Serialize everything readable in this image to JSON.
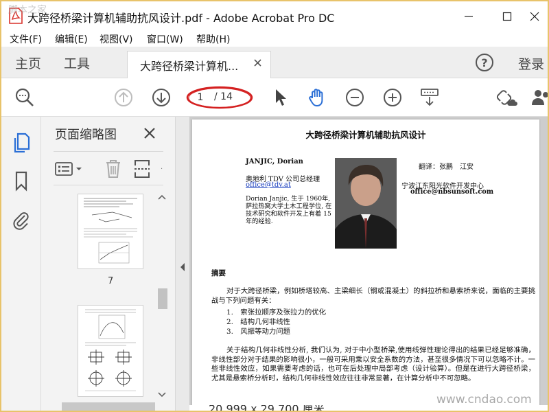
{
  "window": {
    "title": "大跨径桥梁计算机辅助抗风设计.pdf - Adobe Acrobat Pro DC"
  },
  "menu": [
    "文件(F)",
    "编辑(E)",
    "视图(V)",
    "窗口(W)",
    "帮助(H)"
  ],
  "tabs": {
    "home": "主页",
    "tools": "工具",
    "document": "大跨径桥梁计算机...",
    "login": "登录"
  },
  "toolbar": {
    "page_current": "1",
    "page_total": "/ 14"
  },
  "panel": {
    "title": "页面缩略图",
    "page_label": "7"
  },
  "document": {
    "title": "大跨径桥梁计算机辅助抗风设计",
    "author_name": "JANJIC, Dorian",
    "author_org": "奥地利 TDV 公司总经理",
    "author_email": "office@tdv.at",
    "author_bio": "Dorian Janjic, 生于 1960年, 萨拉热窝大学土木工程学位, 在技术研究和软件开发上有着 15年的经验.",
    "translator": "翻译：张鹏　江安",
    "translator_company": "宁波江东阳光软件开发中心",
    "translator_email": "office@nbsunsoft.com",
    "abstract_heading": "摘要",
    "para1": "对于大跨径桥梁，例如桥塔较高、主梁细长（钢或混凝土）的斜拉桥和悬索桥来说，面临的主要挑战与下列问题有关：",
    "list": [
      "1.　索张拉顺序及张拉力的优化",
      "2.　结构几何非线性",
      "3.　风振等动力问题"
    ],
    "para2": "关于结构几何非线性分析, 我们认为, 对于中小型桥梁,使用线弹性理论得出的结果已经足够准确，非线性部分对于结果的影响很小，一般可采用乘以安全系数的方法，甚至很多情况下可以忽略不计。一些非线性效应，如果需要考虑的话，也可在后处理中局部考虑（设计验算）。但是在进行大跨径桥梁，尤其是悬索桥分析时，结构几何非线性效应往往非常显著，在计算分析中不可忽略。"
  },
  "statusbar": {
    "page_size": "20.999 x 29.700 厘米"
  },
  "watermark": {
    "top_left": "脚本之家",
    "bottom_right": "www.cndao.com"
  },
  "colors": {
    "accent_blue": "#2b6fd6",
    "annotation_red": "#d42020",
    "acrobat_red": "#d8302a"
  }
}
